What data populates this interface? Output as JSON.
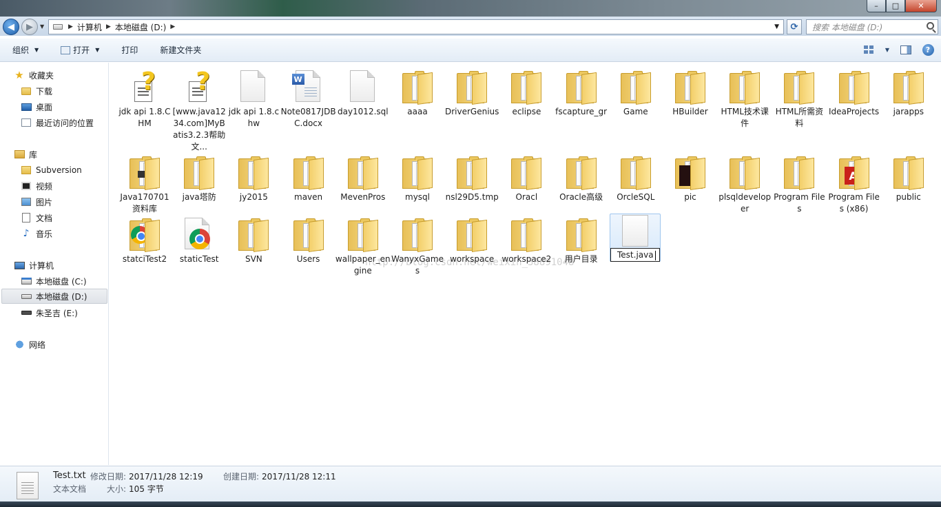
{
  "window": {
    "buttons": {
      "minimize": "–",
      "maximize": "□",
      "close": "✕"
    }
  },
  "address": {
    "crumbs": [
      "计算机",
      "本地磁盘 (D:)"
    ],
    "search_placeholder": "搜索 本地磁盘 (D:)"
  },
  "toolbar": {
    "organize": "组织",
    "open": "打开",
    "print": "打印",
    "new_folder": "新建文件夹"
  },
  "nav": {
    "favorites": "收藏夹",
    "downloads": "下载",
    "desktop": "桌面",
    "recent": "最近访问的位置",
    "libraries": "库",
    "subversion": "Subversion",
    "videos": "视频",
    "pictures": "图片",
    "documents": "文档",
    "music": "音乐",
    "computer": "计算机",
    "drive_c": "本地磁盘 (C:)",
    "drive_d": "本地磁盘 (D:)",
    "drive_e": "朱圣吉 (E:)",
    "network": "网络"
  },
  "files": [
    {
      "name": "jdk api 1.8.CHM",
      "type": "chm"
    },
    {
      "name": "[www.java1234.com]MyBatis3.2.3帮助文...",
      "type": "chm"
    },
    {
      "name": "jdk api 1.8.chw",
      "type": "doc"
    },
    {
      "name": "Note0817JDBC.docx",
      "type": "docx"
    },
    {
      "name": "day1012.sql",
      "type": "doc"
    },
    {
      "name": "aaaa",
      "type": "folder"
    },
    {
      "name": "DriverGenius",
      "type": "folder"
    },
    {
      "name": "eclipse",
      "type": "folder"
    },
    {
      "name": "fscapture_gr",
      "type": "folder"
    },
    {
      "name": "Game",
      "type": "folder"
    },
    {
      "name": "HBuilder",
      "type": "folder"
    },
    {
      "name": "HTML技术课件",
      "type": "folder"
    },
    {
      "name": "HTML所需资料",
      "type": "folder"
    },
    {
      "name": "IdeaProjects",
      "type": "folder"
    },
    {
      "name": "jarapps",
      "type": "folder"
    },
    {
      "name": "Java170701资料库",
      "type": "folder-pic"
    },
    {
      "name": "java塔防",
      "type": "folder"
    },
    {
      "name": "jy2015",
      "type": "folder"
    },
    {
      "name": "maven",
      "type": "folder"
    },
    {
      "name": "MevenPros",
      "type": "folder"
    },
    {
      "name": "mysql",
      "type": "folder"
    },
    {
      "name": "nsl29D5.tmp",
      "type": "folder"
    },
    {
      "name": "Oracl",
      "type": "folder"
    },
    {
      "name": "Oracle高级",
      "type": "folder"
    },
    {
      "name": "OrcleSQL",
      "type": "folder"
    },
    {
      "name": "pic",
      "type": "folder-dark"
    },
    {
      "name": "plsqldeveloper",
      "type": "folder"
    },
    {
      "name": "Program Files",
      "type": "folder"
    },
    {
      "name": "Program Files (x86)",
      "type": "folder-adobe"
    },
    {
      "name": "public",
      "type": "folder"
    },
    {
      "name": "statciTest2",
      "type": "folder-chrome"
    },
    {
      "name": "staticTest",
      "type": "chrome"
    },
    {
      "name": "SVN",
      "type": "folder"
    },
    {
      "name": "Users",
      "type": "folder"
    },
    {
      "name": "wallpaper_engine",
      "type": "folder"
    },
    {
      "name": "WanyxGames",
      "type": "folder"
    },
    {
      "name": "workspace",
      "type": "folder"
    },
    {
      "name": "workspace2",
      "type": "folder"
    },
    {
      "name": "用户目录",
      "type": "folder"
    }
  ],
  "rename": {
    "value": "Test.java"
  },
  "watermark": "http://blog.csdn.net/weixin_38891048",
  "details": {
    "name": "Test.txt",
    "type": "文本文档",
    "modified_label": "修改日期:",
    "modified": "2017/11/28 12:19",
    "created_label": "创建日期:",
    "created": "2017/11/28 12:11",
    "size_label": "大小:",
    "size": "105 字节"
  }
}
